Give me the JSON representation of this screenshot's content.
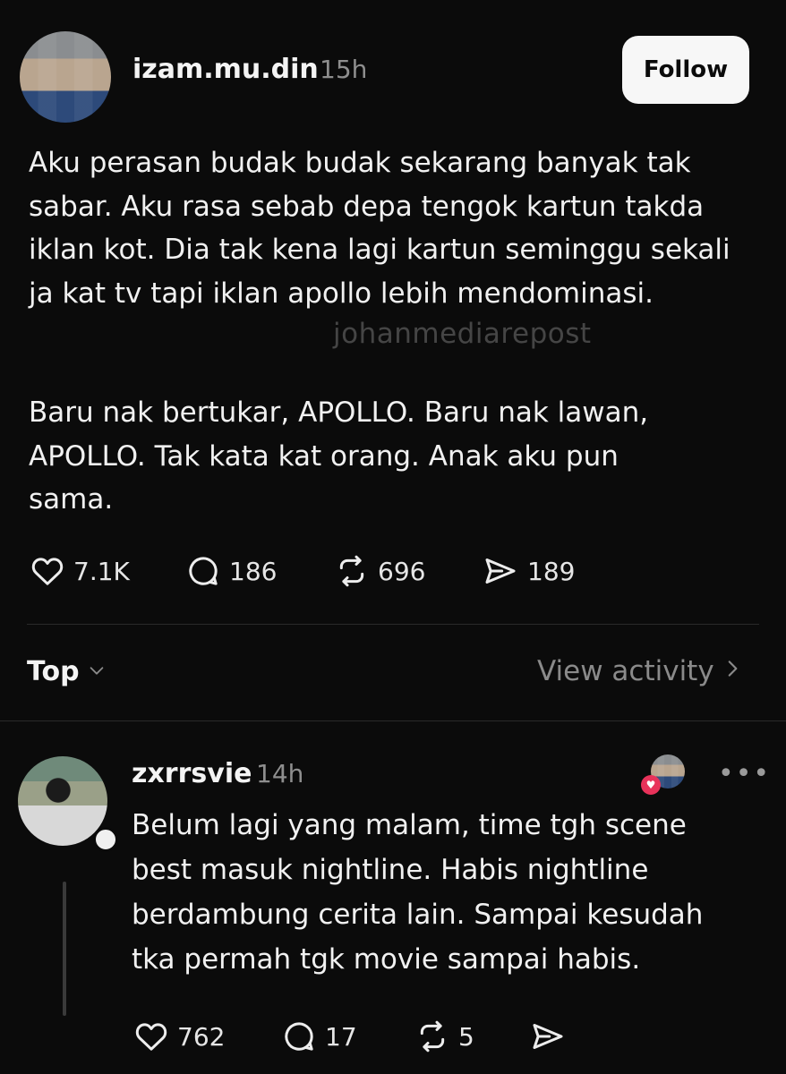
{
  "post": {
    "username": "izam.mu.din",
    "time": "15h",
    "follow_label": "Follow",
    "paragraphs": [
      "Aku perasan budak budak sekarang banyak tak sabar. Aku rasa sebab depa tengok kartun takda iklan kot. Dia tak kena lagi kartun seminggu sekali ja kat tv tapi iklan apollo lebih mendominasi.",
      "Baru nak bertukar, APOLLO. Baru nak lawan, APOLLO. Tak kata kat orang. Anak aku pun sama."
    ],
    "watermark": "johanmediarepost",
    "actions": {
      "likes": "7.1K",
      "comments": "186",
      "reposts": "696",
      "shares": "189"
    }
  },
  "replies_header": {
    "sort_label": "Top",
    "view_activity_label": "View activity"
  },
  "reply": {
    "username": "zxrrsvie",
    "time": "14h",
    "text": "Belum lagi yang malam, time tgh scene best masuk nightline. Habis nightline berdambung cerita lain. Sampai kesudah tka permah tgk movie sampai habis.",
    "more_label": "•••",
    "actions": {
      "likes": "762",
      "comments": "17",
      "reposts": "5"
    }
  },
  "icons": {
    "like": "heart-icon",
    "comment": "comment-icon",
    "repost": "repost-icon",
    "share": "send-icon",
    "chevron_down": "chevron-down-icon",
    "chevron_right": "chevron-right-icon"
  },
  "colors": {
    "background": "#0b0b0b",
    "text": "#f2f2f2",
    "muted": "#8e8e8e",
    "follow_bg": "#f7f7f7",
    "heart_badge": "#e8325a"
  }
}
